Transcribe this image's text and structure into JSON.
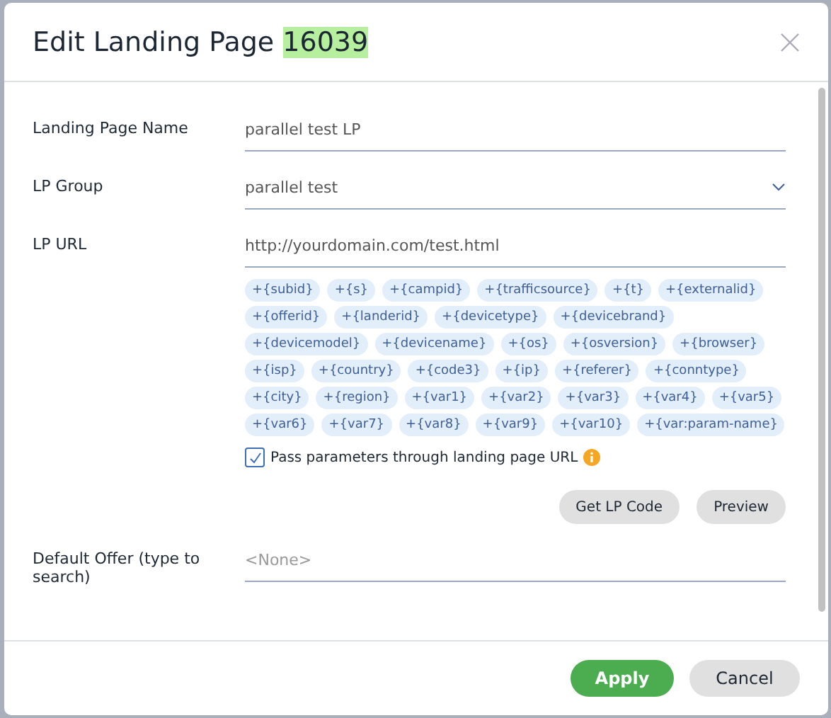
{
  "dialog": {
    "title": "Edit Landing Page",
    "title_id": "16039"
  },
  "fields": [
    {
      "kind": "text",
      "label": "Landing Page Name",
      "value": "parallel test LP"
    },
    {
      "kind": "select",
      "label": "LP Group",
      "value": "parallel test"
    },
    {
      "kind": "url",
      "label": "LP URL",
      "value": "http://yourdomain.com/test.html",
      "tokens": [
        "+{subid}",
        "+{s}",
        "+{campid}",
        "+{trafficsource}",
        "+{t}",
        "+{externalid}",
        "+{offerid}",
        "+{landerid}",
        "+{devicetype}",
        "+{devicebrand}",
        "+{devicemodel}",
        "+{devicename}",
        "+{os}",
        "+{osversion}",
        "+{browser}",
        "+{isp}",
        "+{country}",
        "+{code3}",
        "+{ip}",
        "+{referer}",
        "+{conntype}",
        "+{city}",
        "+{region}",
        "+{var1}",
        "+{var2}",
        "+{var3}",
        "+{var4}",
        "+{var5}",
        "+{var6}",
        "+{var7}",
        "+{var8}",
        "+{var9}",
        "+{var10}",
        "+{var:param-name}"
      ],
      "checkbox": {
        "label": "Pass parameters through landing page URL",
        "checked": true
      },
      "buttons": [
        "Get LP Code",
        "Preview"
      ]
    },
    {
      "kind": "text",
      "label": "Default Offer (type to search)",
      "placeholder": "<None>"
    }
  ],
  "footer": {
    "buttons": [
      {
        "label": "Apply",
        "kind": "primary"
      },
      {
        "label": "Cancel",
        "kind": "secondary"
      }
    ]
  }
}
